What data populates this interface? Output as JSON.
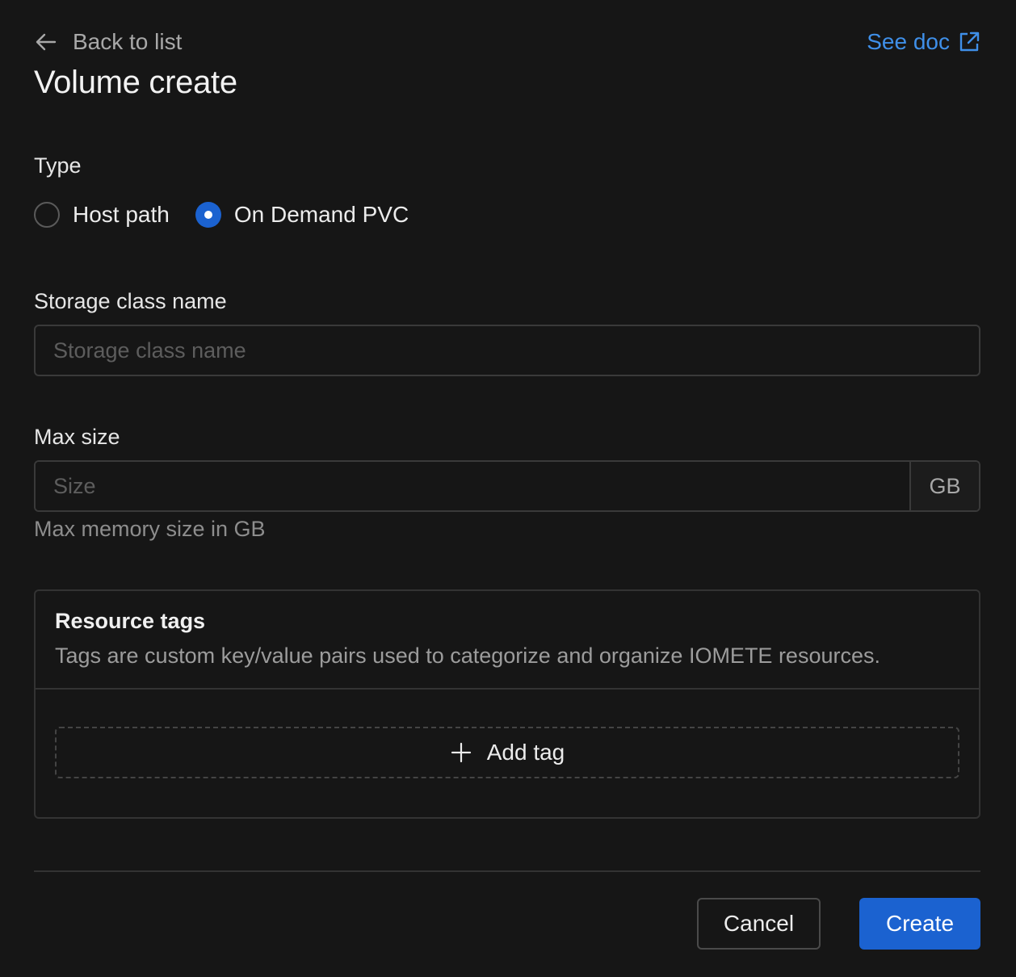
{
  "header": {
    "back_label": "Back to list",
    "back_icon": "arrow-left-icon",
    "doc_label": "See doc",
    "doc_icon": "external-link-icon",
    "title": "Volume create"
  },
  "form": {
    "type": {
      "label": "Type",
      "options": [
        {
          "label": "Host path",
          "checked": false
        },
        {
          "label": "On Demand PVC",
          "checked": true
        }
      ]
    },
    "storage_class": {
      "label": "Storage class name",
      "placeholder": "Storage class name",
      "value": ""
    },
    "max_size": {
      "label": "Max size",
      "placeholder": "Size",
      "value": "",
      "unit": "GB",
      "help": "Max memory size in GB"
    },
    "resource_tags": {
      "title": "Resource tags",
      "description": "Tags are custom key/value pairs used to categorize and organize IOMETE resources.",
      "add_label": "Add tag",
      "add_icon": "plus-icon"
    }
  },
  "footer": {
    "cancel_label": "Cancel",
    "create_label": "Create"
  },
  "colors": {
    "background": "#161616",
    "accent": "#1b62d0",
    "link": "#3f8fe8"
  }
}
